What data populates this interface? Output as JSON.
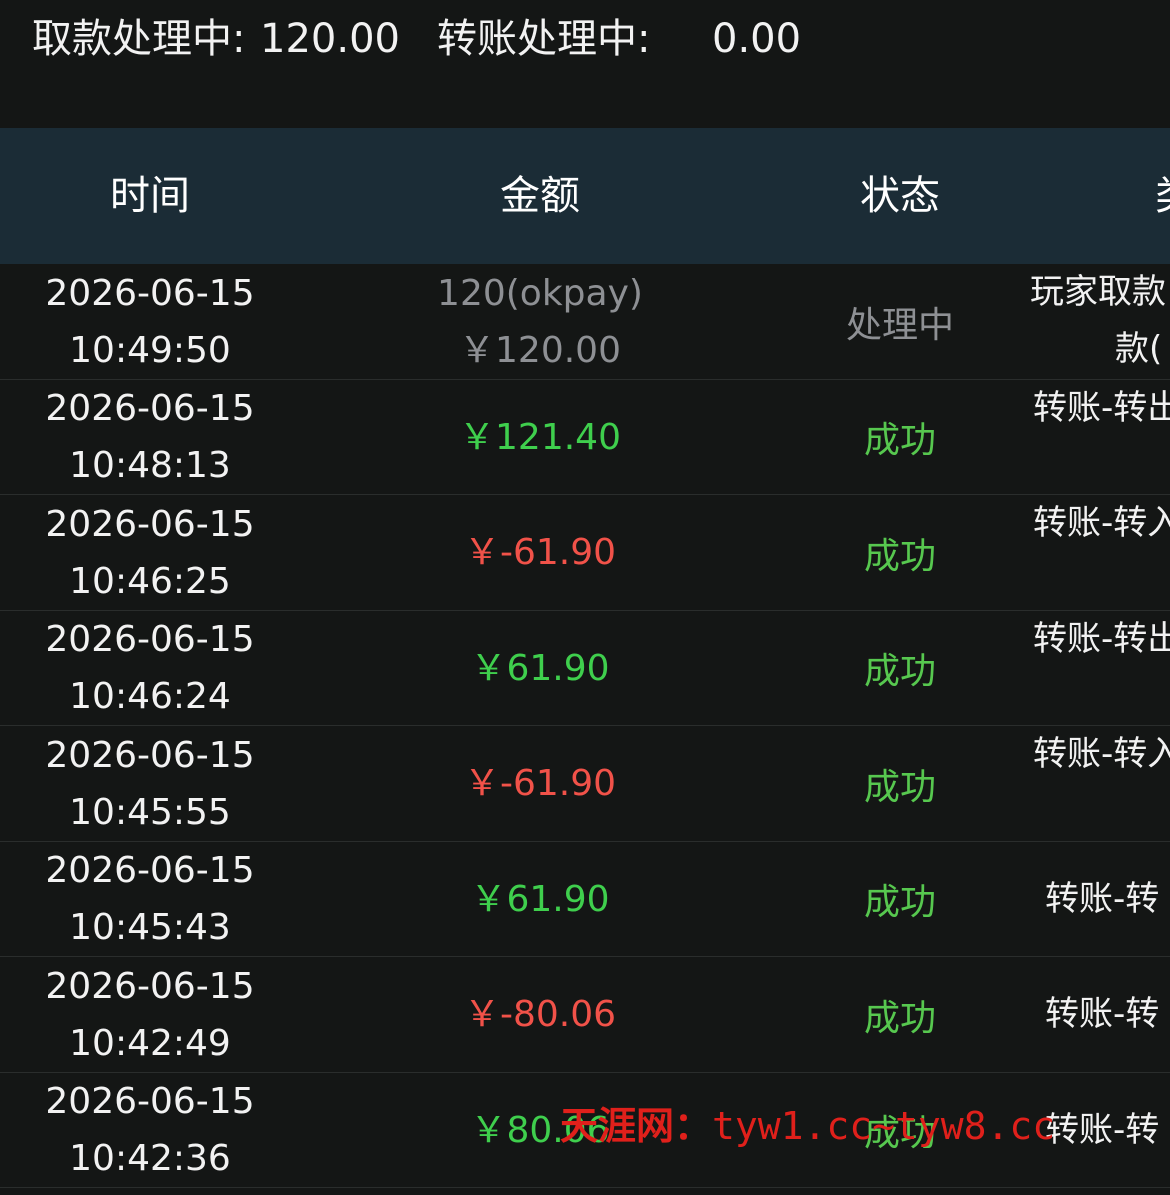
{
  "summary": {
    "withdraw_label": "取款处理中:",
    "withdraw_value": "120.00",
    "transfer_label": "转账处理中:",
    "transfer_value": "0.00"
  },
  "columns": {
    "time": "时间",
    "amount": "金额",
    "status": "状态",
    "type": "类"
  },
  "rows": [
    {
      "date": "2026-06-15",
      "time": "10:49:50",
      "amount_note": "120(okpay)",
      "amount": "￥120.00",
      "status": "处理中",
      "type_l1": "玩家取款",
      "type_l2": "款("
    },
    {
      "date": "2026-06-15",
      "time": "10:48:13",
      "amount_note": "",
      "amount": "￥121.40",
      "status": "成功",
      "type_l1": "转账-转出",
      "type_l2": ""
    },
    {
      "date": "2026-06-15",
      "time": "10:46:25",
      "amount_note": "",
      "amount": "￥-61.90",
      "status": "成功",
      "type_l1": "转账-转入",
      "type_l2": ""
    },
    {
      "date": "2026-06-15",
      "time": "10:46:24",
      "amount_note": "",
      "amount": "￥61.90",
      "status": "成功",
      "type_l1": "转账-转出",
      "type_l2": ""
    },
    {
      "date": "2026-06-15",
      "time": "10:45:55",
      "amount_note": "",
      "amount": "￥-61.90",
      "status": "成功",
      "type_l1": "转账-转入",
      "type_l2": ""
    },
    {
      "date": "2026-06-15",
      "time": "10:45:43",
      "amount_note": "",
      "amount": "￥61.90",
      "status": "成功",
      "type_l1": "转账-转",
      "type_l2": ""
    },
    {
      "date": "2026-06-15",
      "time": "10:42:49",
      "amount_note": "",
      "amount": "￥-80.06",
      "status": "成功",
      "type_l1": "转账-转",
      "type_l2": ""
    },
    {
      "date": "2026-06-15",
      "time": "10:42:36",
      "amount_note": "",
      "amount": "￥80.06",
      "status": "成功",
      "type_l1": "转账-转",
      "type_l2": ""
    }
  ],
  "watermark": {
    "site": "天涯网：",
    "domains": "tyw1.cc~tyw8.cc"
  },
  "colors": {
    "background": "#141615",
    "header_bg": "#1b2c36",
    "positive": "#3fcf4d",
    "negative": "#f15249",
    "pending": "#8e9094",
    "success": "#57c84f",
    "watermark": "#e0201b"
  }
}
